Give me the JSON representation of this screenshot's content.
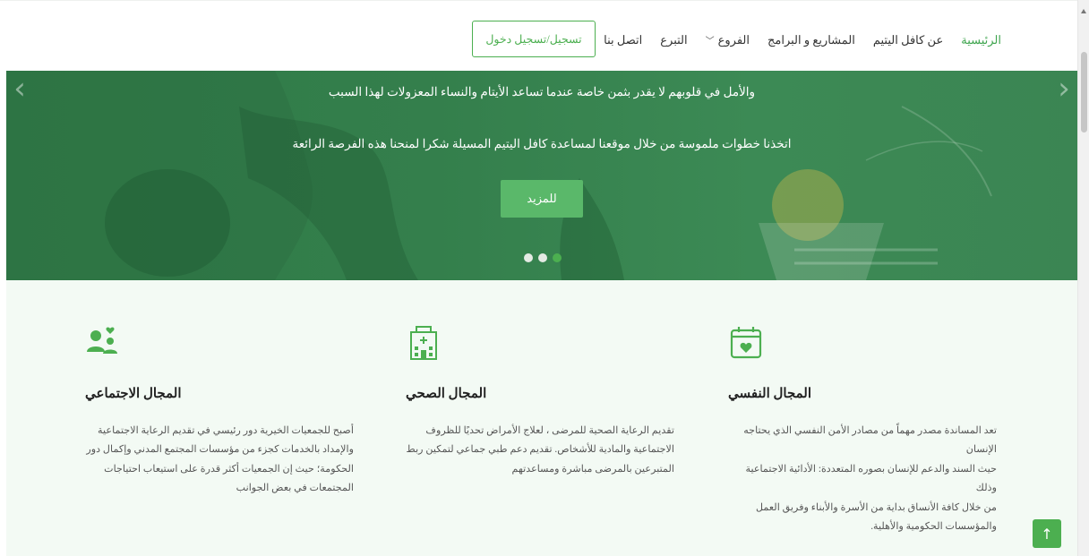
{
  "nav": {
    "items": [
      {
        "label": "الرئيسية",
        "active": true
      },
      {
        "label": "عن كافل اليتيم"
      },
      {
        "label": "المشاريع و البرامج"
      },
      {
        "label": "الفروع",
        "dropdown": true
      },
      {
        "label": "التبرع"
      },
      {
        "label": "اتصل بنا"
      }
    ],
    "login_label": "تسجيل/تسجيل دخول"
  },
  "hero": {
    "line1": "والأمل في قلوبهم لا يقدر بثمن خاصة عندما تساعد الأيتام والنساء المعزولات لهذا السبب",
    "line2": "اتخذنا خطوات ملموسة من خلال موقعنا لمساعدة كافل اليتيم المسيلة شكرا لمنحنا هذه الفرصة الرائعة",
    "more_label": "للمزيد",
    "prev_arrow": "‹",
    "next_arrow": "›",
    "active_dot": 3,
    "dot_count": 3
  },
  "features": {
    "social": {
      "icon": "people-heart-icon",
      "title": "المجال الاجتماعي",
      "lines": [
        "أصبح للجمعيات الخيرية دور رئيسي في تقديم الرعاية الاجتماعية",
        "والإمداد بالخدمات كجزء من مؤسسات المجتمع المدني وإكمال دور",
        "الحكومة؛ حيث إن الجمعيات أكثر قدرة على استيعاب احتياجات",
        "المجتمعات في بعض الجوانب"
      ]
    },
    "health": {
      "icon": "hospital-icon",
      "title": "المجال الصحي",
      "lines": [
        "تقديم الرعاية الصحية للمرضى ، لعلاج الأمراض تحديًا للظروف",
        "الاجتماعية والمادية للأشخاص. تقديم دعم طبي جماعي لتمكين ربط",
        "المتبرعين بالمرضى مباشرة ومساعدتهم"
      ]
    },
    "psych": {
      "icon": "calendar-heart-icon",
      "title": "المجال النفسي",
      "lines": [
        "تعد المساندة مصدر مهماً من مصادر الأمن النفسي الذي يحتاجه الإنسان",
        "حيث السند والدعم للإنسان بصوره المتعددة: الأدائية الاجتماعية وذلك",
        "من خلال كافة الأنساق بداية من الأسرة والأبناء وفريق العمل",
        "والمؤسسات الحكومية والأهلية."
      ]
    }
  },
  "scroll_top_icon": "↑",
  "colors": {
    "accent": "#4caf50",
    "hero_green": "#347f4c",
    "features_bg": "#f3faf4"
  }
}
